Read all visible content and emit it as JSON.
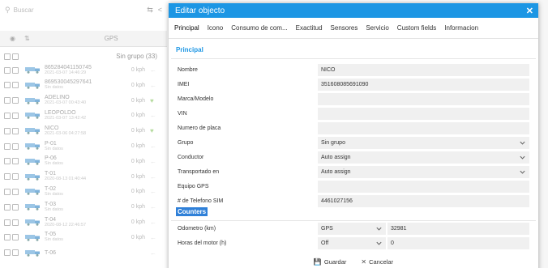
{
  "background": {
    "search_placeholder": "Buscar",
    "gps_header": "GPS",
    "group_label": "Sin grupo (33)",
    "rows": [
      {
        "name": "865284041150745",
        "date": "2021-03-07 14:46:29",
        "speed": "0 kph",
        "heart": false
      },
      {
        "name": "869530045297641",
        "date": "Sin datos",
        "speed": "0 kph",
        "heart": false
      },
      {
        "name": "ADELINO",
        "date": "2021-03-07 00:43:40",
        "speed": "0 kph",
        "heart": true
      },
      {
        "name": "LEOPOLDO",
        "date": "2021-03-07 13:42:42",
        "speed": "0 kph",
        "heart": false
      },
      {
        "name": "NICO",
        "date": "2021-03-06 04:27:58",
        "speed": "0 kph",
        "heart": true
      },
      {
        "name": "P-01",
        "date": "Sin datos",
        "speed": "0 kph",
        "heart": false
      },
      {
        "name": "P-06",
        "date": "Sin datos",
        "speed": "0 kph",
        "heart": false
      },
      {
        "name": "T-01",
        "date": "2020-08-13 01:40:44",
        "speed": "0 kph",
        "heart": false
      },
      {
        "name": "T-02",
        "date": "Sin datos",
        "speed": "0 kph",
        "heart": false
      },
      {
        "name": "T-03",
        "date": "Sin datos",
        "speed": "0 kph",
        "heart": false
      },
      {
        "name": "T-04",
        "date": "2020-08-12 22:46:57",
        "speed": "0 kph",
        "heart": false
      },
      {
        "name": "T-05",
        "date": "Sin datos",
        "speed": "0 kph",
        "heart": false
      },
      {
        "name": "T-06",
        "date": "",
        "speed": "",
        "heart": false
      }
    ]
  },
  "dialog": {
    "title": "Editar objecto",
    "tabs": [
      "Principal",
      "Icono",
      "Consumo de com...",
      "Exactitud",
      "Sensores",
      "Servicio",
      "Custom fields",
      "Informacion"
    ],
    "section_principal": "Principal",
    "fields": {
      "nombre": {
        "label": "Nombre",
        "value": "NICO"
      },
      "imei": {
        "label": "IMEI",
        "value": "351608085691090"
      },
      "marca": {
        "label": "Marca/Modelo",
        "value": ""
      },
      "vin": {
        "label": "VIN",
        "value": ""
      },
      "placa": {
        "label": "Numero de placa",
        "value": ""
      },
      "grupo": {
        "label": "Grupo",
        "value": "Sin grupo"
      },
      "conductor": {
        "label": "Conductor",
        "value": "Auto assign"
      },
      "transportado": {
        "label": "Transportado en",
        "value": "Auto assign"
      },
      "equipo": {
        "label": "Equipo GPS",
        "value": ""
      },
      "sim": {
        "label": "# de Telefono SIM",
        "value": "4461027156"
      }
    },
    "section_counters": "Counters",
    "counters": {
      "odometro": {
        "label": "Odometro (km)",
        "source": "GPS",
        "value": "32981"
      },
      "horas": {
        "label": "Horas del motor (h)",
        "source": "Off",
        "value": "0"
      }
    },
    "footer": {
      "save": "Guardar",
      "cancel": "Cancelar"
    }
  },
  "colors": {
    "accent": "#1c96e4",
    "highlight": "#2f80d8",
    "field_bg": "#f0f0f0"
  }
}
